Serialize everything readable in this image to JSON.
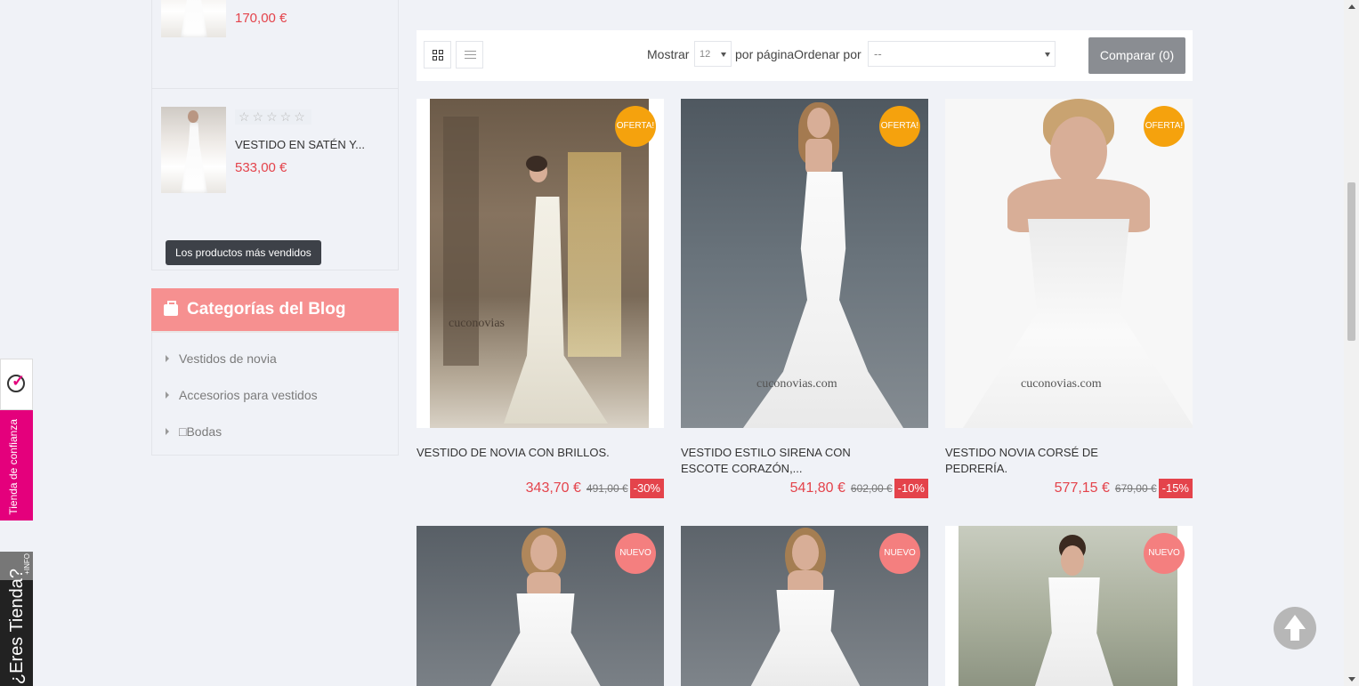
{
  "sidebar": {
    "top_product": {
      "price": "170,00 €"
    },
    "product": {
      "stars": "☆☆☆☆☆",
      "name": "VESTIDO EN SATÉN Y...",
      "price": "533,00 €"
    },
    "best_sellers_button": "Los productos más vendidos",
    "blog": {
      "title": "Categorías del Blog",
      "items": [
        {
          "label": "Vestidos de novia"
        },
        {
          "label": "Accesorios para vestidos"
        },
        {
          "label": "□Bodas"
        }
      ]
    }
  },
  "toolbar": {
    "show_label": "Mostrar",
    "per_page_value": "12",
    "per_page_label": "por páginaOrdenar por",
    "order_value": "--",
    "compare_label": "Comparar (0)"
  },
  "products": [
    {
      "badge": "OFERTA!",
      "name": "VESTIDO DE NOVIA CON BRILLOS.",
      "price": "343,70 €",
      "old_price": "491,00 €",
      "discount": "-30%",
      "watermark": "cuconovias"
    },
    {
      "badge": "OFERTA!",
      "name": "VESTIDO ESTILO SIRENA CON ESCOTE CORAZÓN,...",
      "price": "541,80 €",
      "old_price": "602,00 €",
      "discount": "-10%",
      "watermark": "cuconovias.com"
    },
    {
      "badge": "OFERTA!",
      "name": "VESTIDO NOVIA CORSÉ DE PEDRERÍA.",
      "price": "577,15 €",
      "old_price": "679,00 €",
      "discount": "-15%",
      "watermark": "cuconovias.com"
    },
    {
      "badge": "NUEVO"
    },
    {
      "badge": "NUEVO"
    },
    {
      "badge": "NUEVO"
    }
  ],
  "widgets": {
    "trust_label": "Tienda de confianza",
    "info_label": "+INFO",
    "eres_label": "¿Eres Tienda?"
  },
  "icons": {
    "grid_view": "grid-icon",
    "list_view": "list-icon",
    "blog": "briefcase-icon",
    "scroll_top": "arrow-up-icon"
  },
  "colors": {
    "accent_price": "#e4434b",
    "blog_header": "#f69090",
    "sale_badge": "#f5a20d",
    "new_badge": "#f47f7f",
    "trust_pink": "#e4007c"
  }
}
